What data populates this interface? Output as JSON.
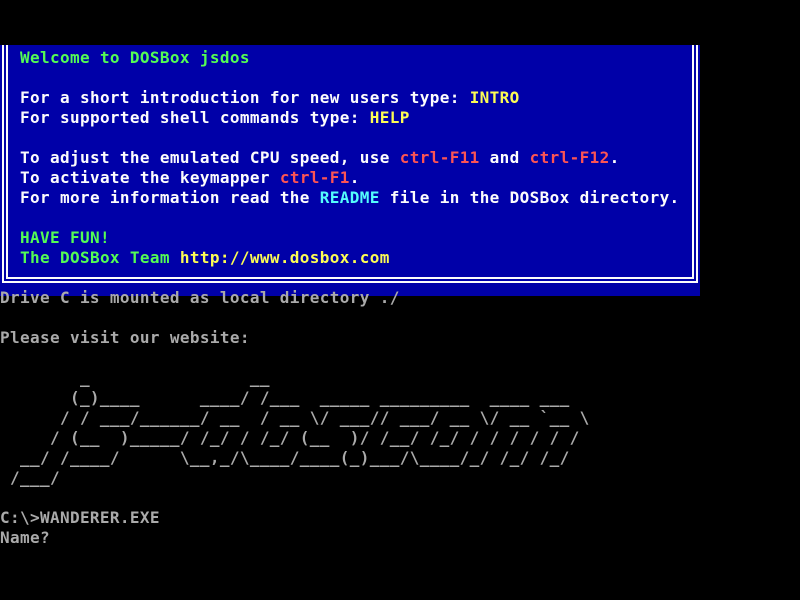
{
  "app": {
    "name": "DOSBox jsdos terminal",
    "screen_cols": 80,
    "screen_rows": 25
  },
  "colors": {
    "background": "#000000",
    "box_blue": "#0000a8",
    "white": "#fcfcfc",
    "gray": "#aaaaaa",
    "green": "#54fc54",
    "yellow": "#fcfc54",
    "red": "#fc5454",
    "cyan": "#54fcfc"
  },
  "welcome_box": {
    "border_style": "double-line",
    "lines": [
      {
        "segments": [
          {
            "text": "Welcome to DOSBox jsdos",
            "color": "green"
          }
        ]
      },
      {
        "segments": []
      },
      {
        "segments": [
          {
            "text": "For a short introduction for new users type: ",
            "color": "white"
          },
          {
            "text": "INTRO",
            "color": "yellow"
          }
        ]
      },
      {
        "segments": [
          {
            "text": "For supported shell commands type: ",
            "color": "white"
          },
          {
            "text": "HELP",
            "color": "yellow"
          }
        ]
      },
      {
        "segments": []
      },
      {
        "segments": [
          {
            "text": "To adjust the emulated CPU speed, use ",
            "color": "white"
          },
          {
            "text": "ctrl-F11",
            "color": "red"
          },
          {
            "text": " and ",
            "color": "white"
          },
          {
            "text": "ctrl-F12",
            "color": "red"
          },
          {
            "text": ".",
            "color": "white"
          }
        ]
      },
      {
        "segments": [
          {
            "text": "To activate the keymapper ",
            "color": "white"
          },
          {
            "text": "ctrl-F1",
            "color": "red"
          },
          {
            "text": ".",
            "color": "white"
          }
        ]
      },
      {
        "segments": [
          {
            "text": "For more information read the ",
            "color": "white"
          },
          {
            "text": "README",
            "color": "cyan"
          },
          {
            "text": " file in the DOSBox directory.",
            "color": "white"
          }
        ]
      },
      {
        "segments": []
      },
      {
        "segments": [
          {
            "text": "HAVE FUN!",
            "color": "green"
          }
        ]
      },
      {
        "segments": [
          {
            "text": "The DOSBox Team ",
            "color": "green"
          },
          {
            "text": "http://www.dosbox.com",
            "color": "yellow"
          }
        ]
      }
    ]
  },
  "console": {
    "drive_message": "Drive C is mounted as local directory ./",
    "website_prompt": "Please visit our website:",
    "ascii_art_name": "js-dos.com",
    "ascii_art_lines": [
      "        _                __",
      "       (_)____      ____/ /___  _____ _________  ____ ___",
      "      / / ___/______/ __  / __ \\/ ___// ___/ __ \\/ __ `__ \\",
      "     / (__  )_____/ /_/ / /_/ (__  )/ /__/ /_/ / / / / / /",
      "  __/ /____/      \\__,_/\\____/____(_)___/\\____/_/ /_/ /_/",
      " /___/"
    ],
    "command_line": "C:\\>WANDERER.EXE",
    "name_prompt": "Name?"
  }
}
